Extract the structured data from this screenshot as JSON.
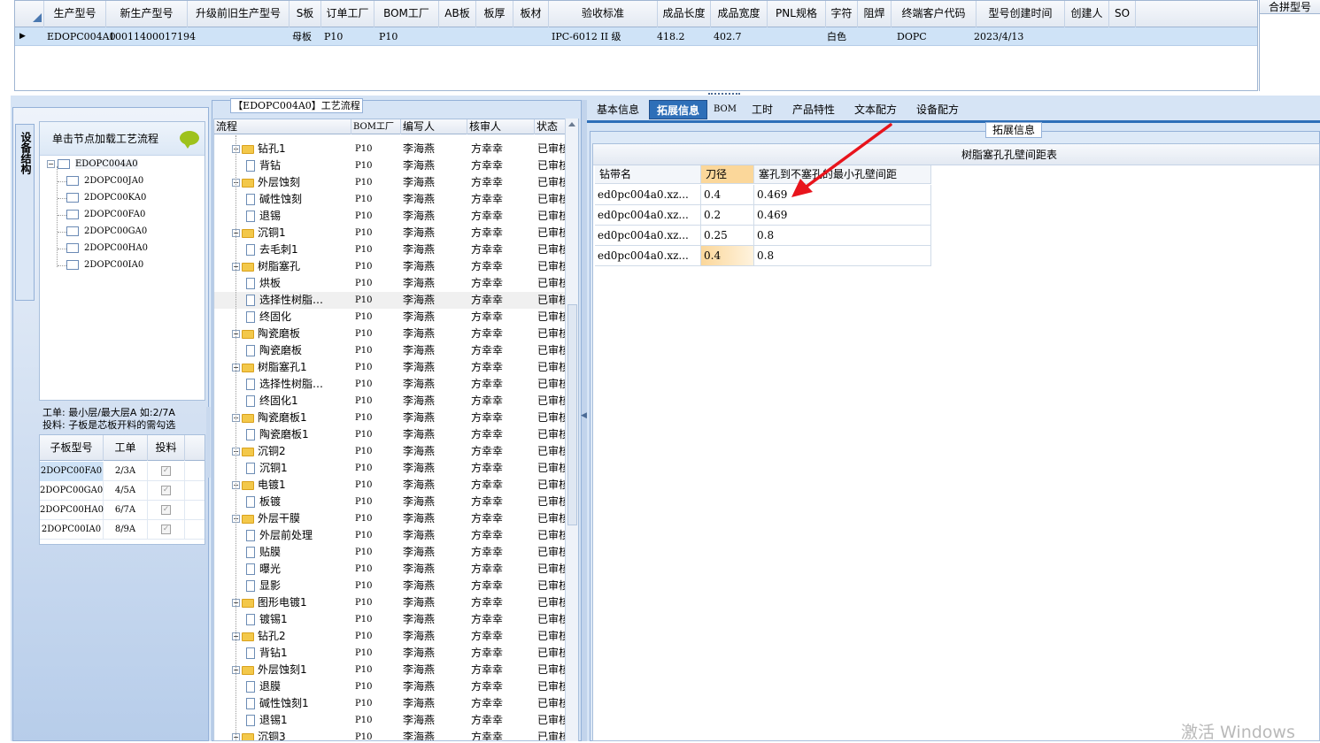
{
  "top_grid": {
    "headers": [
      "生产型号",
      "新生产型号",
      "升级前旧生产型号",
      "S板",
      "订单工厂",
      "BOM工厂",
      "AB板",
      "板厚",
      "板材",
      "验收标准",
      "成品长度",
      "成品宽度",
      "PNL规格",
      "字符",
      "阻焊",
      "终端客户代码",
      "型号创建时间",
      "创建人",
      "SO"
    ],
    "row": {
      "生产型号": "EDOPC004A0",
      "新生产型号": "10011400017194",
      "S板": "母板",
      "订单工厂": "P10",
      "BOM工厂": "P10",
      "验收标准": "IPC-6012 II 级",
      "成品长度": "418.2",
      "成品宽度": "402.7",
      "字符": "白色",
      "终端客户代码": "DOPC",
      "型号创建时间": "2023/4/13"
    },
    "right_header": "合拼型号"
  },
  "left_panel": {
    "vertical_tab": "设备结构",
    "load_hint": "单击节点加载工艺流程",
    "tree_root": "EDOPC004A0",
    "tree_children": [
      "2DOPC00JA0",
      "2DOPC00KA0",
      "2DOPC00FA0",
      "2DOPC00GA0",
      "2DOPC00HA0",
      "2DOPC00IA0"
    ],
    "info_line1": "工单: 最小层/最大层A 如:2/7A",
    "info_line2": "投料: 子板是芯板开料的需勾选",
    "sub_grid": {
      "headers": [
        "子板型号",
        "工单",
        "投料"
      ],
      "rows": [
        [
          "2DOPC00FA0",
          "2/3A",
          "✓"
        ],
        [
          "2DOPC00GA0",
          "4/5A",
          "✓"
        ],
        [
          "2DOPC00HA0",
          "6/7A",
          "✓"
        ],
        [
          "2DOPC00IA0",
          "8/9A",
          "✓"
        ]
      ]
    }
  },
  "flow": {
    "title": "【EDOPC004A0】工艺流程",
    "headers": [
      "流程",
      "BOM工厂",
      "编写人",
      "核审人",
      "状态"
    ],
    "rows": [
      {
        "name": "钻孔1",
        "type": "folder",
        "bom": "P10",
        "writer": "李海燕",
        "reviewer": "方幸幸",
        "status": "已审核"
      },
      {
        "name": "背钻",
        "type": "doc",
        "bom": "P10",
        "writer": "李海燕",
        "reviewer": "方幸幸",
        "status": "已审核"
      },
      {
        "name": "外层蚀刻",
        "type": "folder",
        "bom": "P10",
        "writer": "李海燕",
        "reviewer": "方幸幸",
        "status": "已审核"
      },
      {
        "name": "碱性蚀刻",
        "type": "doc",
        "bom": "P10",
        "writer": "李海燕",
        "reviewer": "方幸幸",
        "status": "已审核"
      },
      {
        "name": "退锡",
        "type": "doc",
        "bom": "P10",
        "writer": "李海燕",
        "reviewer": "方幸幸",
        "status": "已审核"
      },
      {
        "name": "沉铜1",
        "type": "folder",
        "bom": "P10",
        "writer": "李海燕",
        "reviewer": "方幸幸",
        "status": "已审核"
      },
      {
        "name": "去毛刺1",
        "type": "doc",
        "bom": "P10",
        "writer": "李海燕",
        "reviewer": "方幸幸",
        "status": "已审核"
      },
      {
        "name": "树脂塞孔",
        "type": "folder",
        "bom": "P10",
        "writer": "李海燕",
        "reviewer": "方幸幸",
        "status": "已审核"
      },
      {
        "name": "烘板",
        "type": "doc",
        "bom": "P10",
        "writer": "李海燕",
        "reviewer": "方幸幸",
        "status": "已审核"
      },
      {
        "name": "选择性树脂…",
        "type": "doc",
        "bom": "P10",
        "writer": "李海燕",
        "reviewer": "方幸幸",
        "status": "已审核",
        "selected": true
      },
      {
        "name": "终固化",
        "type": "doc",
        "bom": "P10",
        "writer": "李海燕",
        "reviewer": "方幸幸",
        "status": "已审核"
      },
      {
        "name": "陶瓷磨板",
        "type": "folder",
        "bom": "P10",
        "writer": "李海燕",
        "reviewer": "方幸幸",
        "status": "已审核"
      },
      {
        "name": "陶瓷磨板",
        "type": "doc",
        "bom": "P10",
        "writer": "李海燕",
        "reviewer": "方幸幸",
        "status": "已审核"
      },
      {
        "name": "树脂塞孔1",
        "type": "folder",
        "bom": "P10",
        "writer": "李海燕",
        "reviewer": "方幸幸",
        "status": "已审核"
      },
      {
        "name": "选择性树脂…",
        "type": "doc",
        "bom": "P10",
        "writer": "李海燕",
        "reviewer": "方幸幸",
        "status": "已审核"
      },
      {
        "name": "终固化1",
        "type": "doc",
        "bom": "P10",
        "writer": "李海燕",
        "reviewer": "方幸幸",
        "status": "已审核"
      },
      {
        "name": "陶瓷磨板1",
        "type": "folder",
        "bom": "P10",
        "writer": "李海燕",
        "reviewer": "方幸幸",
        "status": "已审核"
      },
      {
        "name": "陶瓷磨板1",
        "type": "doc",
        "bom": "P10",
        "writer": "李海燕",
        "reviewer": "方幸幸",
        "status": "已审核"
      },
      {
        "name": "沉铜2",
        "type": "folder",
        "bom": "P10",
        "writer": "李海燕",
        "reviewer": "方幸幸",
        "status": "已审核"
      },
      {
        "name": "沉铜1",
        "type": "doc",
        "bom": "P10",
        "writer": "李海燕",
        "reviewer": "方幸幸",
        "status": "已审核"
      },
      {
        "name": "电镀1",
        "type": "folder",
        "bom": "P10",
        "writer": "李海燕",
        "reviewer": "方幸幸",
        "status": "已审核"
      },
      {
        "name": "板镀",
        "type": "doc",
        "bom": "P10",
        "writer": "李海燕",
        "reviewer": "方幸幸",
        "status": "已审核"
      },
      {
        "name": "外层干膜",
        "type": "folder",
        "bom": "P10",
        "writer": "李海燕",
        "reviewer": "方幸幸",
        "status": "已审核"
      },
      {
        "name": "外层前处理",
        "type": "doc",
        "bom": "P10",
        "writer": "李海燕",
        "reviewer": "方幸幸",
        "status": "已审核"
      },
      {
        "name": "贴膜",
        "type": "doc",
        "bom": "P10",
        "writer": "李海燕",
        "reviewer": "方幸幸",
        "status": "已审核"
      },
      {
        "name": "曝光",
        "type": "doc",
        "bom": "P10",
        "writer": "李海燕",
        "reviewer": "方幸幸",
        "status": "已审核"
      },
      {
        "name": "显影",
        "type": "doc",
        "bom": "P10",
        "writer": "李海燕",
        "reviewer": "方幸幸",
        "status": "已审核"
      },
      {
        "name": "图形电镀1",
        "type": "folder",
        "bom": "P10",
        "writer": "李海燕",
        "reviewer": "方幸幸",
        "status": "已审核"
      },
      {
        "name": "镀锡1",
        "type": "doc",
        "bom": "P10",
        "writer": "李海燕",
        "reviewer": "方幸幸",
        "status": "已审核"
      },
      {
        "name": "钻孔2",
        "type": "folder",
        "bom": "P10",
        "writer": "李海燕",
        "reviewer": "方幸幸",
        "status": "已审核"
      },
      {
        "name": "背钻1",
        "type": "doc",
        "bom": "P10",
        "writer": "李海燕",
        "reviewer": "方幸幸",
        "status": "已审核"
      },
      {
        "name": "外层蚀刻1",
        "type": "folder",
        "bom": "P10",
        "writer": "李海燕",
        "reviewer": "方幸幸",
        "status": "已审核"
      },
      {
        "name": "退膜",
        "type": "doc",
        "bom": "P10",
        "writer": "李海燕",
        "reviewer": "方幸幸",
        "status": "已审核"
      },
      {
        "name": "碱性蚀刻1",
        "type": "doc",
        "bom": "P10",
        "writer": "李海燕",
        "reviewer": "方幸幸",
        "status": "已审核"
      },
      {
        "name": "退锡1",
        "type": "doc",
        "bom": "P10",
        "writer": "李海燕",
        "reviewer": "方幸幸",
        "status": "已审核"
      },
      {
        "name": "沉铜3",
        "type": "folder",
        "bom": "P10",
        "writer": "李海燕",
        "reviewer": "方幸幸",
        "status": "已审核"
      }
    ]
  },
  "tabs": [
    "基本信息",
    "拓展信息",
    "BOM",
    "工时",
    "产品特性",
    "文本配方",
    "设备配方"
  ],
  "active_tab": "拓展信息",
  "ext": {
    "group_label": "拓展信息",
    "table_title": "树脂塞孔孔壁间距表",
    "headers": [
      "钻带名",
      "刀径",
      "塞孔到不塞孔的最小孔壁间距"
    ],
    "rows": [
      [
        "ed0pc004a0.xz...",
        "0.4",
        "0.469"
      ],
      [
        "ed0pc004a0.xz...",
        "0.2",
        "0.469"
      ],
      [
        "ed0pc004a0.xz...",
        "0.25",
        "0.8"
      ],
      [
        "ed0pc004a0.xz...",
        "0.4",
        "0.8"
      ]
    ]
  },
  "watermark": "激活 Windows",
  "colors": {
    "accent": "#2e6fb8",
    "highlight": "#fbd79a",
    "arrow": "#e8141c",
    "selection_row": "#cfe3f7"
  }
}
